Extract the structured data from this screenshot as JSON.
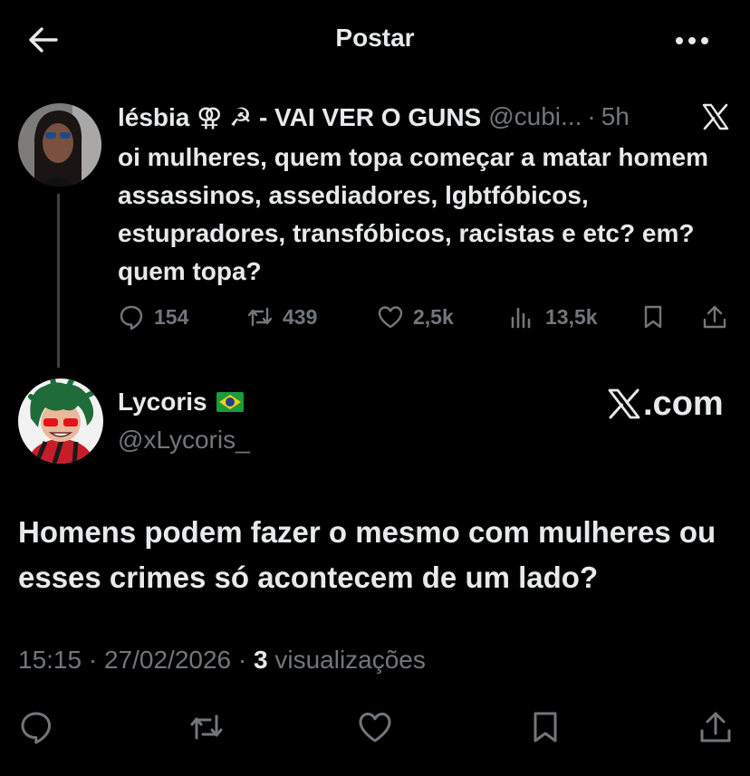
{
  "header": {
    "title": "Postar"
  },
  "parent_tweet": {
    "display_name": "lésbia ⚢ ☭ - VAI VER O GUNS",
    "handle": "@cubi...",
    "separator": "·",
    "time": "5h",
    "text": "oi mulheres, quem topa começar a matar homem assassinos, assediadores, lgbtfóbicos, estupradores, transfóbicos, racistas e etc? em? quem topa?",
    "stats": {
      "replies": "154",
      "reposts": "439",
      "likes": "2,5k",
      "views": "13,5k"
    }
  },
  "reply_tweet": {
    "display_name": "Lycoris",
    "handle": "@xLycoris_",
    "watermark": ".com",
    "text": "Homens podem fazer o mesmo com mulheres ou esses crimes só acontecem de um lado?",
    "time": "15:15",
    "date": "27/02/2026",
    "views_count": "3",
    "views_label": "visualizações"
  },
  "icons": [
    "back-arrow-icon",
    "more-icon",
    "x-logo-icon",
    "reply-icon",
    "repost-icon",
    "like-icon",
    "views-icon",
    "bookmark-icon",
    "share-icon",
    "brazil-flag-icon"
  ]
}
